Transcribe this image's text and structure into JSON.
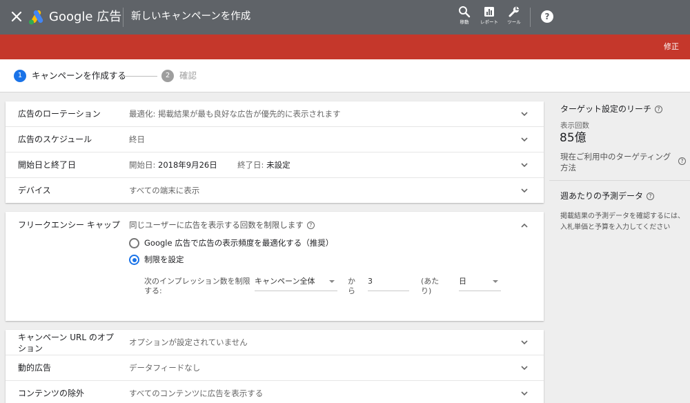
{
  "header": {
    "brand": "Google 広告",
    "title": "新しいキャンペーンを作成",
    "tools": [
      {
        "label": "移動",
        "icon": "search-icon"
      },
      {
        "label": "レポート",
        "icon": "bar-chart-icon"
      },
      {
        "label": "ツール",
        "icon": "wrench-icon"
      }
    ],
    "help": "?"
  },
  "alert_bar": {
    "action": "修正"
  },
  "stepper": {
    "steps": [
      {
        "num": "1",
        "label": "キャンペーンを作成する"
      },
      {
        "num": "2",
        "label": "確認"
      }
    ]
  },
  "settings_top": [
    {
      "label": "広告のローテーション",
      "value": "最適化: 掲載結果が最も良好な広告が優先的に表示されます"
    },
    {
      "label": "広告のスケジュール",
      "value": "終日"
    },
    {
      "label": "開始日と終了日",
      "start_label": "開始日:",
      "start_value": "2018年9月26日",
      "end_label": "終了日:",
      "end_value": "未設定"
    },
    {
      "label": "デバイス",
      "value": "すべての端末に表示"
    }
  ],
  "frequency_cap": {
    "label": "フリークエンシー キャップ",
    "description": "同じユーザーに広告を表示する回数を制限します",
    "options": [
      {
        "label": "Google 広告で広告の表示頻度を最適化する（推奨）",
        "selected": false
      },
      {
        "label": "制限を設定",
        "selected": true
      }
    ],
    "limit": {
      "prefix_line1": "次のインプレッション数を制限",
      "prefix_line2": "する:",
      "scope": "キャンペーン全体",
      "from_line1": "か",
      "from_line2": "ら",
      "count": "3",
      "per_line1": "(あた",
      "per_line2": "り)",
      "period": "日"
    }
  },
  "settings_bottom": [
    {
      "label": "キャンペーン URL のオプション",
      "value": "オプションが設定されていません"
    },
    {
      "label": "動的広告",
      "value": "データフィードなし"
    },
    {
      "label": "コンテンツの除外",
      "value": "すべてのコンテンツに広告を表示する"
    }
  ],
  "sidebar": {
    "reach": {
      "title": "ターゲット設定のリーチ",
      "metric_label": "表示回数",
      "metric_value": "85億",
      "note": "現在ご利用中のターゲティング方法"
    },
    "forecast": {
      "title": "週あたりの予測データ",
      "note": "掲載結果の予測データを確認するには、入札単価と予算を入力してください"
    }
  },
  "colors": {
    "header_bg": "#5f6368",
    "alert_bg": "#c5372b",
    "accent": "#1a73e8",
    "step_inactive": "#9e9e9e"
  }
}
